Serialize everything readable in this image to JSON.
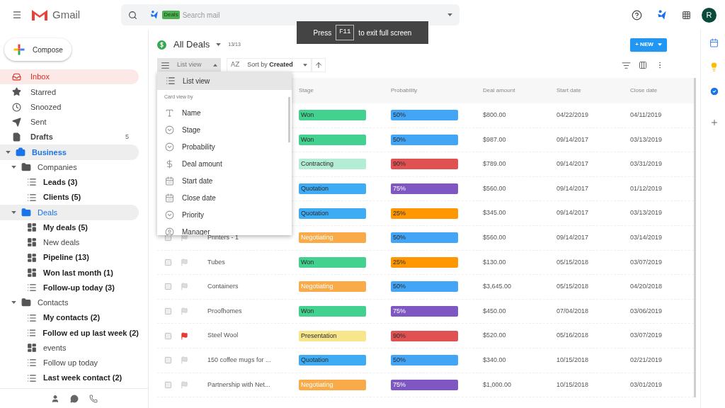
{
  "header": {
    "app_name": "Gmail",
    "search": {
      "chip": "Deals",
      "placeholder": "Search mail"
    },
    "avatar": "R"
  },
  "toast": {
    "before": "Press",
    "key": "F11",
    "after": "to exit full screen"
  },
  "sidebar": {
    "compose": "Compose",
    "mail": [
      {
        "label": "Inbox",
        "kind": "inbox",
        "selected": true,
        "unread": false
      },
      {
        "label": "Starred",
        "kind": "star",
        "selected": false,
        "unread": false
      },
      {
        "label": "Snoozed",
        "kind": "clock",
        "selected": false,
        "unread": false
      },
      {
        "label": "Sent",
        "kind": "send",
        "selected": false,
        "unread": false
      },
      {
        "label": "Drafts",
        "kind": "file",
        "selected": false,
        "unread": true,
        "count": "5"
      }
    ],
    "tree": [
      {
        "label": "Business",
        "kind": "briefcase",
        "expanded": true,
        "selected": true,
        "children": [
          {
            "label": "Companies",
            "kind": "folder",
            "expanded": true,
            "selected": false,
            "children": [
              {
                "label": "Leads (3)",
                "kind": "list",
                "unread": true
              },
              {
                "label": "Clients (5)",
                "kind": "list",
                "unread": true
              }
            ]
          },
          {
            "label": "Deals",
            "kind": "folder",
            "expanded": true,
            "selected": true,
            "children": [
              {
                "label": "My deals (5)",
                "kind": "board",
                "unread": true
              },
              {
                "label": "New deals",
                "kind": "board",
                "unread": false
              },
              {
                "label": "Pipeline (13)",
                "kind": "board",
                "unread": true
              },
              {
                "label": "Won last month (1)",
                "kind": "board",
                "unread": true
              },
              {
                "label": "Follow-up today (3)",
                "kind": "list",
                "unread": true
              }
            ]
          },
          {
            "label": "Contacts",
            "kind": "folder",
            "expanded": true,
            "selected": false,
            "children": [
              {
                "label": "My contacts (2)",
                "kind": "list",
                "unread": true
              },
              {
                "label": "Follow ed up last week (2)",
                "kind": "list",
                "unread": true
              },
              {
                "label": "events",
                "kind": "board",
                "unread": false
              },
              {
                "label": "Follow up today",
                "kind": "list",
                "unread": false
              },
              {
                "label": "Last week contact (2)",
                "kind": "list",
                "unread": true
              }
            ]
          }
        ]
      }
    ]
  },
  "main": {
    "title": "All Deals",
    "count": "13/13",
    "new_button": "+ NEW",
    "view_button": {
      "label": "List view",
      "open": true
    },
    "sort": {
      "icon_text": "AZ",
      "prefix": "Sort by",
      "field": "Created"
    },
    "menu": {
      "items": [
        {
          "label": "List view",
          "kind": "list",
          "selected": true
        }
      ],
      "section": "Card view by",
      "fields": [
        {
          "label": "Name",
          "kind": "text"
        },
        {
          "label": "Stage",
          "kind": "dropdown"
        },
        {
          "label": "Probability",
          "kind": "dropdown"
        },
        {
          "label": "Deal amount",
          "kind": "dollar"
        },
        {
          "label": "Start date",
          "kind": "calendar"
        },
        {
          "label": "Close date",
          "kind": "calendar"
        },
        {
          "label": "Priority",
          "kind": "dropdown"
        },
        {
          "label": "Manager",
          "kind": "person"
        }
      ]
    },
    "table": {
      "columns": [
        "Stage",
        "Probability",
        "Deal amount",
        "Start date",
        "Close date"
      ],
      "rows": [
        {
          "stage": {
            "label": "Won",
            "color": "#43d18f"
          },
          "probability": {
            "label": "50%",
            "color": "#42a5f5"
          },
          "amount": "$800.00",
          "start": "04/22/2019",
          "close": "04/11/2019"
        },
        {
          "stage": {
            "label": "Won",
            "color": "#43d18f"
          },
          "probability": {
            "label": "50%",
            "color": "#42a5f5"
          },
          "amount": "$987.00",
          "start": "09/14/2017",
          "close": "03/13/2019"
        },
        {
          "stage": {
            "label": "Contracting",
            "color": "#b4edd5"
          },
          "probability": {
            "label": "90%",
            "color": "#e05252"
          },
          "amount": "$789.00",
          "start": "09/14/2017",
          "close": "03/31/2019"
        },
        {
          "stage": {
            "label": "Quotation",
            "color": "#3eabf5"
          },
          "probability": {
            "label": "75%",
            "color": "#7e57c2"
          },
          "amount": "$560.00",
          "start": "09/14/2017",
          "close": "01/12/2019"
        },
        {
          "stage": {
            "label": "Quotation",
            "color": "#3eabf5"
          },
          "probability": {
            "label": "25%",
            "color": "#ff9800"
          },
          "amount": "$345.00",
          "start": "09/14/2017",
          "close": "03/13/2019"
        },
        {
          "name": "Printers - 1",
          "checked": false,
          "flagged": false,
          "stage": {
            "label": "Negotiating",
            "color": "#f9ab4a"
          },
          "probability": {
            "label": "50%",
            "color": "#42a5f5"
          },
          "amount": "$560.00",
          "start": "09/14/2017",
          "close": "03/14/2019"
        },
        {
          "name": "Tubes",
          "checked": false,
          "flagged": false,
          "stage": {
            "label": "Won",
            "color": "#43d18f"
          },
          "probability": {
            "label": "25%",
            "color": "#ff9800"
          },
          "amount": "$130.00",
          "start": "05/15/2018",
          "close": "03/07/2019"
        },
        {
          "name": "Containers",
          "checked": false,
          "flagged": false,
          "stage": {
            "label": "Negotiating",
            "color": "#f9ab4a"
          },
          "probability": {
            "label": "50%",
            "color": "#42a5f5"
          },
          "amount": "$3,645.00",
          "start": "05/15/2018",
          "close": "04/20/2018"
        },
        {
          "name": "Proofhomes",
          "checked": false,
          "flagged": false,
          "stage": {
            "label": "Won",
            "color": "#43d18f"
          },
          "probability": {
            "label": "75%",
            "color": "#7e57c2"
          },
          "amount": "$450.00",
          "start": "07/04/2018",
          "close": "03/06/2019"
        },
        {
          "name": "Steel Wool",
          "checked": false,
          "flagged": true,
          "stage": {
            "label": "Presentation",
            "color": "#f7e68b"
          },
          "probability": {
            "label": "90%",
            "color": "#e05252"
          },
          "amount": "$520.00",
          "start": "05/16/2018",
          "close": "03/07/2019"
        },
        {
          "name": "150 coffee mugs for ...",
          "checked": false,
          "flagged": false,
          "stage": {
            "label": "Quotation",
            "color": "#3eabf5"
          },
          "probability": {
            "label": "50%",
            "color": "#42a5f5"
          },
          "amount": "$340.00",
          "start": "10/15/2018",
          "close": "02/21/2019"
        },
        {
          "name": "Partnership with Net...",
          "checked": false,
          "flagged": false,
          "stage": {
            "label": "Negotiating",
            "color": "#f9ab4a"
          },
          "probability": {
            "label": "75%",
            "color": "#7e57c2"
          },
          "amount": "$1,000.00",
          "start": "10/15/2018",
          "close": "03/01/2019"
        }
      ]
    }
  }
}
